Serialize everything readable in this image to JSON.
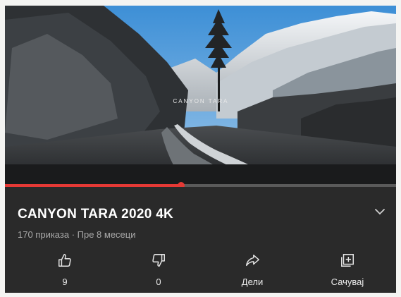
{
  "video": {
    "overlay_title": "CANYON TARA",
    "progress_fraction": 0.45
  },
  "title": "CANYON TARA 2020 4K",
  "meta": "170 приказа · Пре 8 месеци",
  "actions": [
    {
      "id": "like",
      "label": "9",
      "icon": "thumbs-up-icon"
    },
    {
      "id": "dislike",
      "label": "0",
      "icon": "thumbs-down-icon"
    },
    {
      "id": "share",
      "label": "Дели",
      "icon": "share-icon"
    },
    {
      "id": "save",
      "label": "Сачувај",
      "icon": "add-to-playlist-icon"
    }
  ],
  "colors": {
    "progress": "#e53935",
    "panel": "#2a2a2a",
    "text": "#ffffff",
    "muted": "#a9a9a9"
  }
}
